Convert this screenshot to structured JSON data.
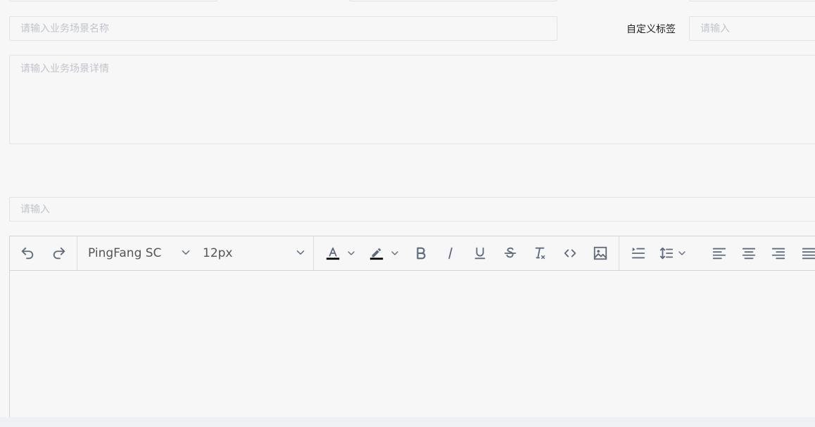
{
  "form": {
    "scene_name_placeholder": "请输入业务场景名称",
    "custom_tag_label": "自定义标签",
    "custom_tag_placeholder": "请输入",
    "scene_detail_placeholder": "请输入业务场景详情",
    "generic_input_placeholder": "请输入"
  },
  "editor": {
    "font_family": "PingFang SC",
    "font_size": "12px",
    "icons": [
      "undo-icon",
      "redo-icon",
      "font-color-icon",
      "highlight-icon",
      "bold-icon",
      "italic-icon",
      "underline-icon",
      "strikethrough-icon",
      "clear-format-icon",
      "code-icon",
      "image-icon",
      "indent-icon",
      "line-height-icon",
      "align-left-icon",
      "align-center-icon",
      "align-right-icon",
      "align-justify-icon"
    ]
  },
  "colors": {
    "background": "#f7f7f7",
    "border": "#e3e3e3",
    "placeholder": "#c0c4cc",
    "icon": "#5f6b7a"
  }
}
